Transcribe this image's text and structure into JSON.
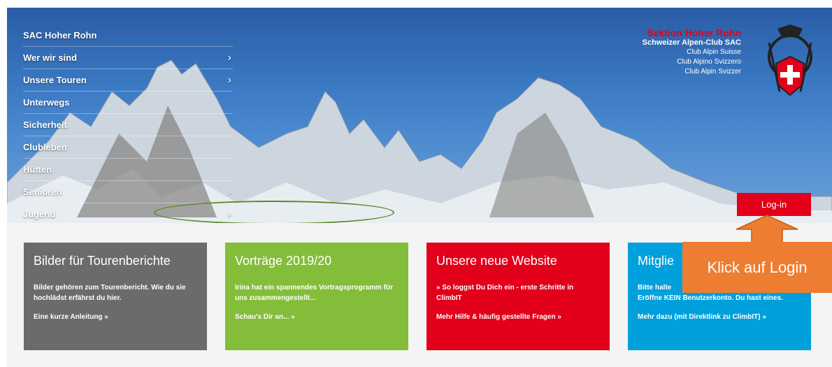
{
  "nav": {
    "items": [
      {
        "label": "SAC Hoher Rohn",
        "chevron": ""
      },
      {
        "label": "Wer wir sind",
        "chevron": "›"
      },
      {
        "label": "Unsere Touren",
        "chevron": "›"
      },
      {
        "label": "Unterwegs",
        "chevron": ""
      },
      {
        "label": "Sicherheit",
        "chevron": ""
      },
      {
        "label": "Clubleben",
        "chevron": ""
      },
      {
        "label": "Hütten",
        "chevron": ""
      },
      {
        "label": "Senioren",
        "chevron": "›"
      },
      {
        "label": "Jugend",
        "chevron": "›"
      }
    ]
  },
  "brand": {
    "title": "Sektion Hoher Rohn",
    "subtitle": "Schweizer Alpen-Club SAC",
    "lang1": "Club Alpin Suisse",
    "lang2": "Club Alpino Svizzero",
    "lang3": "Club Alpin Svizzer"
  },
  "login": {
    "label": "Log-in"
  },
  "cards": [
    {
      "title": "Bilder für Tourenberichte",
      "text": "Bilder gehören zum Tourenbericht. Wie du sie hochlädst erfährst du hier.",
      "text2": "",
      "link": "Eine kurze Anleitung »",
      "color": "#6b6b6b"
    },
    {
      "title": "Vorträge 2019/20",
      "text": "Irina hat ein spannendes Vortragsprogramm für uns zusammengestellt...",
      "text2": "",
      "link": "Schau's Dir an... »",
      "color": "#84bd3a"
    },
    {
      "title": "Unsere neue Website",
      "text": "» So loggst Du Dich ein - erste Schritte in ClimbIT",
      "text2": "",
      "link": "Mehr Hilfe & häufig gestellte Fragen »",
      "color": "#e2001a"
    },
    {
      "title": "Mitglie",
      "text": "Bitte halte",
      "text2": "Eröffne KEIN Benutzerkonto. Du hast eines.",
      "link": "Mehr dazu (mit Direktlink zu ClimbIT) »",
      "color": "#00a0dc"
    }
  ],
  "callout": {
    "label": "Klick auf Login"
  },
  "colors": {
    "accent": "#e2001a",
    "callout": "#ed7d31",
    "ellipse": "#5c8a2a"
  }
}
